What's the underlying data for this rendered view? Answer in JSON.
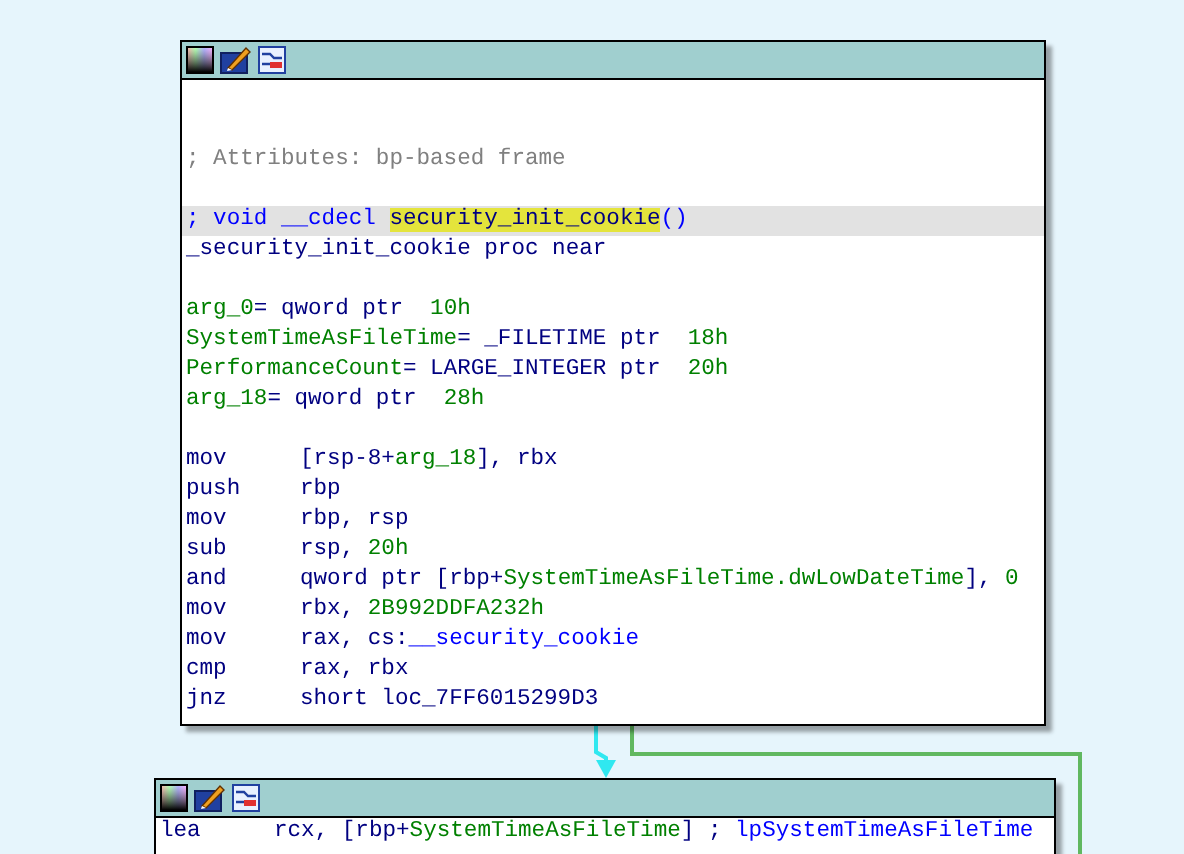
{
  "nodes": [
    {
      "lines": [
        {
          "kind": "blank"
        },
        {
          "kind": "blank"
        },
        {
          "kind": "comment",
          "text": "; Attributes: bp-based frame"
        },
        {
          "kind": "blank"
        },
        {
          "kind": "code",
          "selected": true,
          "tokens": [
            {
              "kind": "keyword",
              "text": "; void __cdecl "
            },
            {
              "kind": "highlight",
              "text": "security_init_cookie"
            },
            {
              "kind": "keyword",
              "text": "()"
            }
          ]
        },
        {
          "kind": "code",
          "selected": false,
          "tokens": [
            {
              "kind": "plain",
              "text": "_security_init_cookie proc near"
            }
          ]
        },
        {
          "kind": "blank"
        },
        {
          "kind": "code",
          "selected": false,
          "tokens": [
            {
              "kind": "var",
              "text": "arg_0"
            },
            {
              "kind": "plain",
              "text": "= qword ptr  "
            },
            {
              "kind": "num",
              "text": "10h"
            }
          ]
        },
        {
          "kind": "code",
          "selected": false,
          "tokens": [
            {
              "kind": "var",
              "text": "SystemTimeAsFileTime"
            },
            {
              "kind": "plain",
              "text": "= _FILETIME ptr  "
            },
            {
              "kind": "num",
              "text": "18h"
            }
          ]
        },
        {
          "kind": "code",
          "selected": false,
          "tokens": [
            {
              "kind": "var",
              "text": "PerformanceCount"
            },
            {
              "kind": "plain",
              "text": "= LARGE_INTEGER ptr  "
            },
            {
              "kind": "num",
              "text": "20h"
            }
          ]
        },
        {
          "kind": "code",
          "selected": false,
          "tokens": [
            {
              "kind": "var",
              "text": "arg_18"
            },
            {
              "kind": "plain",
              "text": "= qword ptr  "
            },
            {
              "kind": "num",
              "text": "28h"
            }
          ]
        },
        {
          "kind": "blank"
        },
        {
          "kind": "instr",
          "mnemonic": "mov",
          "tokens": [
            {
              "kind": "plain",
              "text": "[rsp-8+"
            },
            {
              "kind": "var",
              "text": "arg_18"
            },
            {
              "kind": "plain",
              "text": "], rbx"
            }
          ]
        },
        {
          "kind": "instr",
          "mnemonic": "push",
          "tokens": [
            {
              "kind": "plain",
              "text": "rbp"
            }
          ]
        },
        {
          "kind": "instr",
          "mnemonic": "mov",
          "tokens": [
            {
              "kind": "plain",
              "text": "rbp, rsp"
            }
          ]
        },
        {
          "kind": "instr",
          "mnemonic": "sub",
          "tokens": [
            {
              "kind": "plain",
              "text": "rsp, "
            },
            {
              "kind": "num",
              "text": "20h"
            }
          ]
        },
        {
          "kind": "instr",
          "mnemonic": "and",
          "tokens": [
            {
              "kind": "plain",
              "text": "qword ptr [rbp+"
            },
            {
              "kind": "var",
              "text": "SystemTimeAsFileTime.dwLowDateTime"
            },
            {
              "kind": "plain",
              "text": "], "
            },
            {
              "kind": "num",
              "text": "0"
            }
          ]
        },
        {
          "kind": "instr",
          "mnemonic": "mov",
          "tokens": [
            {
              "kind": "plain",
              "text": "rbx, "
            },
            {
              "kind": "num",
              "text": "2B992DDFA232h"
            }
          ]
        },
        {
          "kind": "instr",
          "mnemonic": "mov",
          "tokens": [
            {
              "kind": "plain",
              "text": "rax, cs:"
            },
            {
              "kind": "name",
              "text": "__security_cookie"
            }
          ]
        },
        {
          "kind": "instr",
          "mnemonic": "cmp",
          "tokens": [
            {
              "kind": "plain",
              "text": "rax, rbx"
            }
          ]
        },
        {
          "kind": "instr",
          "mnemonic": "jnz",
          "tokens": [
            {
              "kind": "plain",
              "text": "short loc_7FF6015299D3"
            }
          ]
        }
      ]
    },
    {
      "lines": [
        {
          "kind": "instr",
          "mnemonic": "lea",
          "tokens": [
            {
              "kind": "plain",
              "text": "rcx, [rbp+"
            },
            {
              "kind": "var",
              "text": "SystemTimeAsFileTime"
            },
            {
              "kind": "plain",
              "text": "] ; "
            },
            {
              "kind": "name",
              "text": "lpSystemTimeAsFileTime"
            }
          ]
        }
      ]
    }
  ]
}
